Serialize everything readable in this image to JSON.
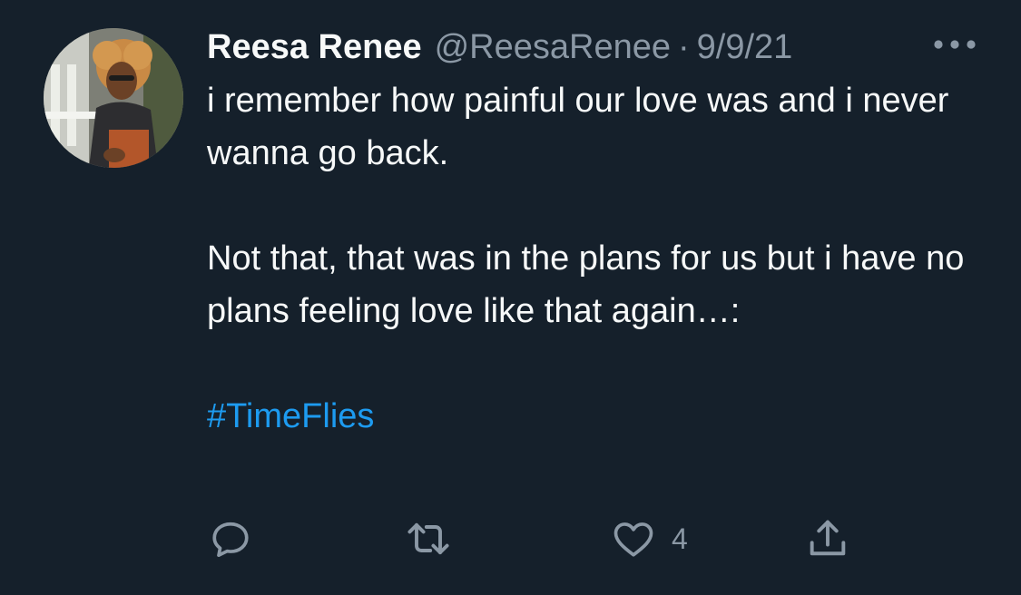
{
  "tweet": {
    "display_name": "Reesa Renee",
    "handle": "@ReesaRenee",
    "separator": "·",
    "date": "9/9/21",
    "paragraphs": [
      "i remember how painful our love was and i never wanna go back.",
      "Not that, that was in the plans for us but i have no plans feeling love like that again…:"
    ],
    "hashtag": "#TimeFlies"
  },
  "actions": {
    "reply_icon": "speech-bubble-icon",
    "retweet_icon": "retweet-arrows-icon",
    "like_icon": "heart-outline-icon",
    "like_count": "4",
    "share_icon": "share-upload-icon"
  },
  "colors": {
    "background": "#15202b",
    "text": "#f7f9f9",
    "muted": "#8b98a5",
    "link": "#1d9bf0"
  }
}
